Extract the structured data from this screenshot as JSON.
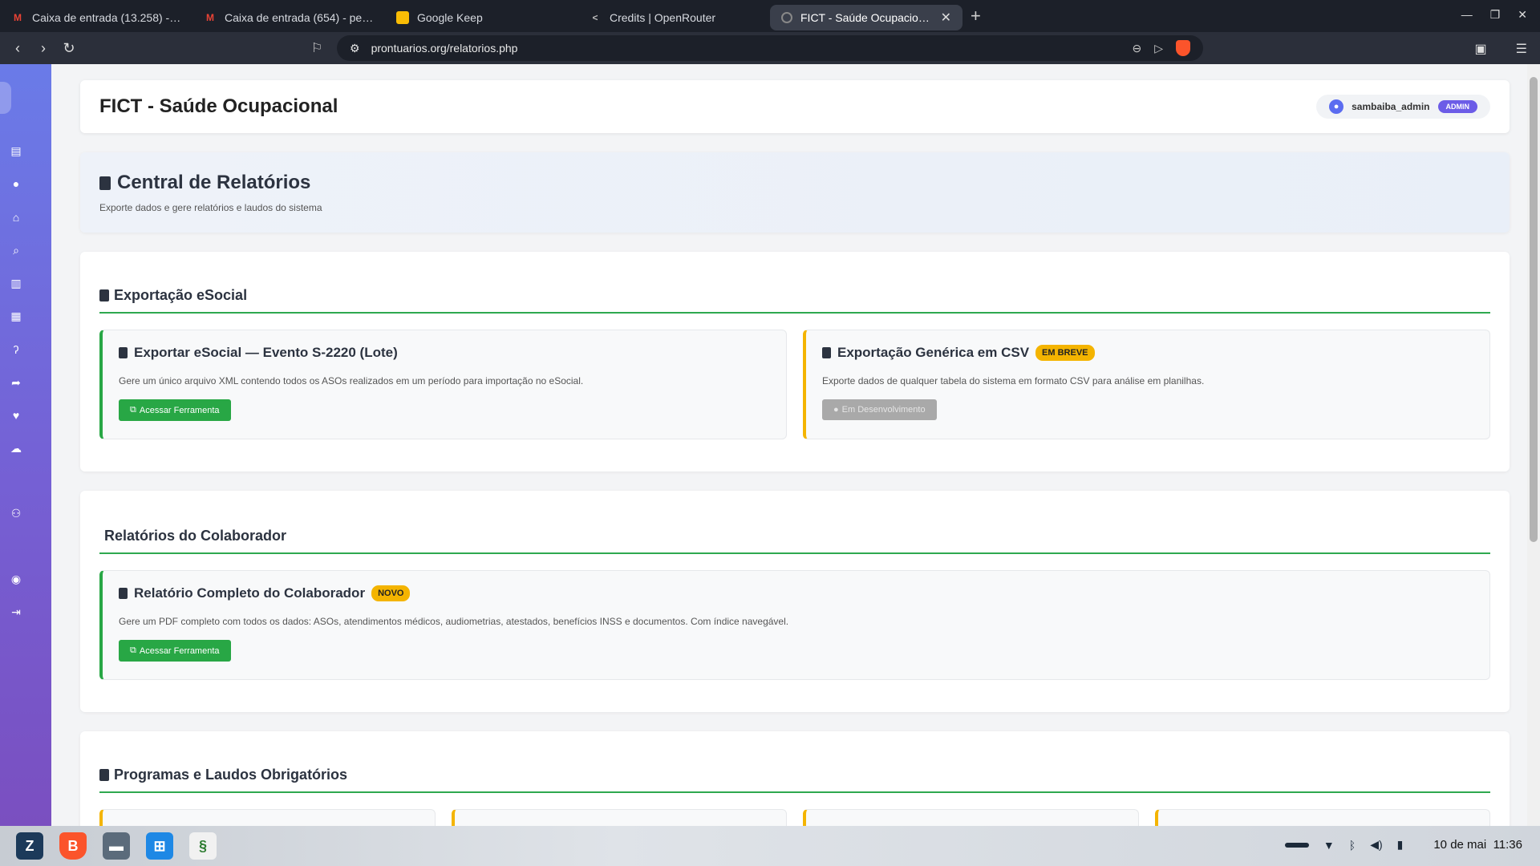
{
  "browser": {
    "tabs": [
      {
        "title": "Caixa de entrada (13.258) - fern",
        "favicon": "gmail-icon"
      },
      {
        "title": "Caixa de entrada (654) - pericia",
        "favicon": "gmail-icon"
      },
      {
        "title": "Google Keep",
        "favicon": "keep-icon"
      },
      {
        "title": "Credits | OpenRouter",
        "favicon": "openrouter-icon"
      },
      {
        "title": "FICT - Saúde Ocupacional",
        "favicon": "globe-icon",
        "active": true
      }
    ],
    "url": "prontuarios.org/relatorios.php"
  },
  "header": {
    "title": "FICT - Saúde Ocupacional",
    "user": "sambaiba_admin",
    "role": "ADMIN"
  },
  "hero": {
    "title": "Central de Relatórios",
    "subtitle": "Exporte dados e gere relatórios e laudos do sistema"
  },
  "sections": {
    "esocial": {
      "title": "Exportação eSocial",
      "cards": [
        {
          "title": "Exportar eSocial — Evento S-2220 (Lote)",
          "description": "Gere um único arquivo XML contendo todos os ASOs realizados em um período para importação no eSocial.",
          "button": "Acessar Ferramenta"
        },
        {
          "title": "Exportação Genérica em CSV",
          "badge": "EM BREVE",
          "description": "Exporte dados de qualquer tabela do sistema em formato CSV para análise em planilhas.",
          "button": "Em Desenvolvimento"
        }
      ]
    },
    "colaborador": {
      "title": "Relatórios do Colaborador",
      "cards": [
        {
          "title": "Relatório Completo do Colaborador",
          "badge": "NOVO",
          "description": "Gere um PDF completo com todos os dados: ASOs, atendimentos médicos, audiometrias, atestados, benefícios INSS e documentos. Com índice navegável.",
          "button": "Acessar Ferramenta"
        }
      ]
    },
    "programas": {
      "title": "Programas e Laudos Obrigatórios"
    }
  },
  "taskbar": {
    "clock_date": "10 de mai",
    "clock_time": "11:36"
  },
  "colors": {
    "accent_green": "#28a745",
    "badge_yellow": "#f4b400",
    "sidebar_top": "#6a7be8",
    "sidebar_bottom": "#7a4fc0"
  }
}
